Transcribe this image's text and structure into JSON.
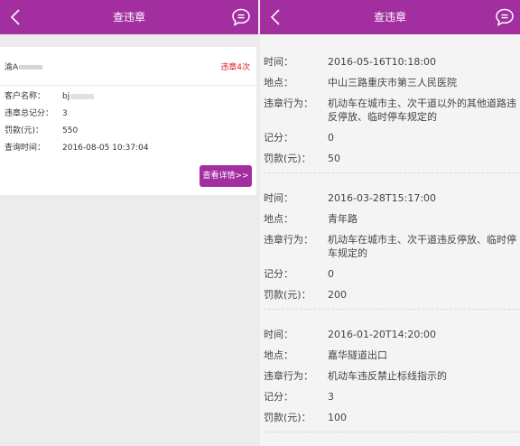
{
  "left": {
    "header": {
      "title": "查违章",
      "back_icon": "chevron-left-icon",
      "message_icon": "chat-bubble-icon"
    },
    "card": {
      "plate": "渝A",
      "violation_count": "违章4次",
      "customer_label": "客户名称：",
      "customer_value": "bj",
      "points_label": "违章总记分：",
      "points_value": "3",
      "fine_label": "罚款(元)：",
      "fine_value": "550",
      "query_time_label": "查询时间：",
      "query_time_value": "2016-08-05 10:37:04",
      "detail_button": "查看详情>>"
    }
  },
  "right": {
    "header": {
      "title": "查违章",
      "back_icon": "chevron-left-icon",
      "message_icon": "chat-bubble-icon"
    },
    "labels": {
      "time": "时间：",
      "place": "地点：",
      "behavior": "违章行为：",
      "points": "记分：",
      "fine": "罚款(元)："
    },
    "records": [
      {
        "time": "2016-05-16T10:18:00",
        "place": "中山三路重庆市第三人民医院",
        "behavior": "机动车在城市主、次干道以外的其他道路违反停放、临时停车规定的",
        "points": "0",
        "fine": "50"
      },
      {
        "time": "2016-03-28T15:17:00",
        "place": "青年路",
        "behavior": "机动车在城市主、次干道违反停放、临时停车规定的",
        "points": "0",
        "fine": "200"
      },
      {
        "time": "2016-01-20T14:20:00",
        "place": "嘉华隧道出口",
        "behavior": "机动车违反禁止标线指示的",
        "points": "3",
        "fine": "100"
      }
    ]
  },
  "colors": {
    "header": "#a22ea0",
    "accent_red": "#e02020",
    "background": "#ececec"
  }
}
